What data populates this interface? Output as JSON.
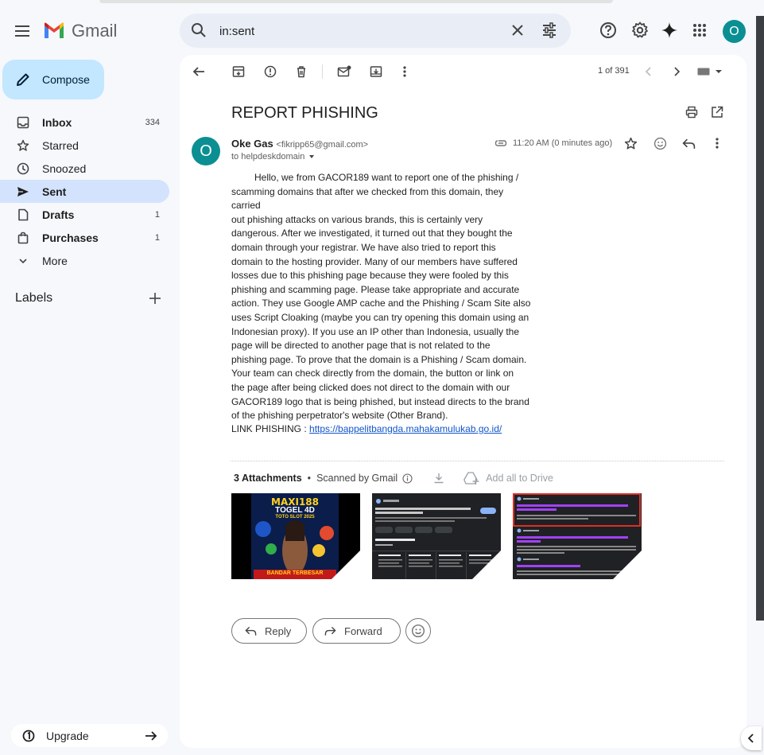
{
  "app": {
    "name": "Gmail",
    "logo_letter": "M",
    "account_initial": "O"
  },
  "search": {
    "value": "in:sent",
    "icon": "search-icon"
  },
  "compose_label": "Compose",
  "sidebar": {
    "items": [
      {
        "label": "Inbox",
        "count": "334",
        "icon": "inbox-icon",
        "bold": true
      },
      {
        "label": "Starred",
        "count": "",
        "icon": "star-icon",
        "bold": false
      },
      {
        "label": "Snoozed",
        "count": "",
        "icon": "clock-icon",
        "bold": false
      },
      {
        "label": "Sent",
        "count": "",
        "icon": "send-icon",
        "bold": true
      },
      {
        "label": "Drafts",
        "count": "1",
        "icon": "draft-icon",
        "bold": true
      },
      {
        "label": "Purchases",
        "count": "1",
        "icon": "purchases-icon",
        "bold": true
      },
      {
        "label": "More",
        "count": "",
        "icon": "chevron-down-icon",
        "bold": false
      }
    ],
    "labels_heading": "Labels",
    "upgrade_label": "Upgrade"
  },
  "toolbar": {
    "pager": "1 of 391"
  },
  "email": {
    "subject": "REPORT PHISHING",
    "sender_initial": "O",
    "sender_name": "Oke Gas",
    "sender_email": "<fikripp65@gmail.com>",
    "to": "to helpdeskdomain",
    "time": "11:20 AM (0 minutes ago)",
    "body_lines": [
      "Hello, we from GACOR189 want to report one of the phishing /",
      "scamming domains that after we checked from this domain, they carried",
      "out phishing attacks on various brands, this is certainly very",
      "dangerous. After we investigated, it turned out that they bought the",
      "domain through your registrar. We have also tried to report this",
      "domain to the hosting provider. Many of our members have suffered",
      "losses due to this phishing page because they were fooled by this",
      "phishing and scamming page. Please take appropriate and accurate",
      "action. They use Google AMP cache and the Phishing / Scam Site also",
      "uses Script Cloaking (maybe you can try opening this domain using an",
      "Indonesian proxy). If you use an IP other than Indonesia, usually the",
      "page will be directed to another page that is not related to the",
      "phishing page. To prove that the domain is a Phishing / Scam domain.",
      "Your team can check directly from the domain, the button or link on",
      "the page after being clicked does not direct to the domain with our",
      "GACOR189 logo that is being phished, but instead directs to the brand",
      "of the phishing perpetrator's website (Other Brand)."
    ],
    "link_prefix": "LINK PHISHING : ",
    "link_url": "https://bappelitbangda.mahakamulukab.go.id/"
  },
  "attachments": {
    "heading": "3 Attachments",
    "scanned": "Scanned by Gmail",
    "add_drive": "Add all to Drive",
    "thumb1": {
      "brand": "MAXI188",
      "line2": "TOGEL 4D",
      "line3": "TOTO SLOT 2025",
      "footer": "BANDAR TERBESAR"
    }
  },
  "actions": {
    "reply": "Reply",
    "forward": "Forward"
  },
  "colors": {
    "accent": "#0b8f92",
    "compose_bg": "#c2e7ff",
    "active_nav": "#d3e3fd",
    "link": "#1155cc"
  }
}
